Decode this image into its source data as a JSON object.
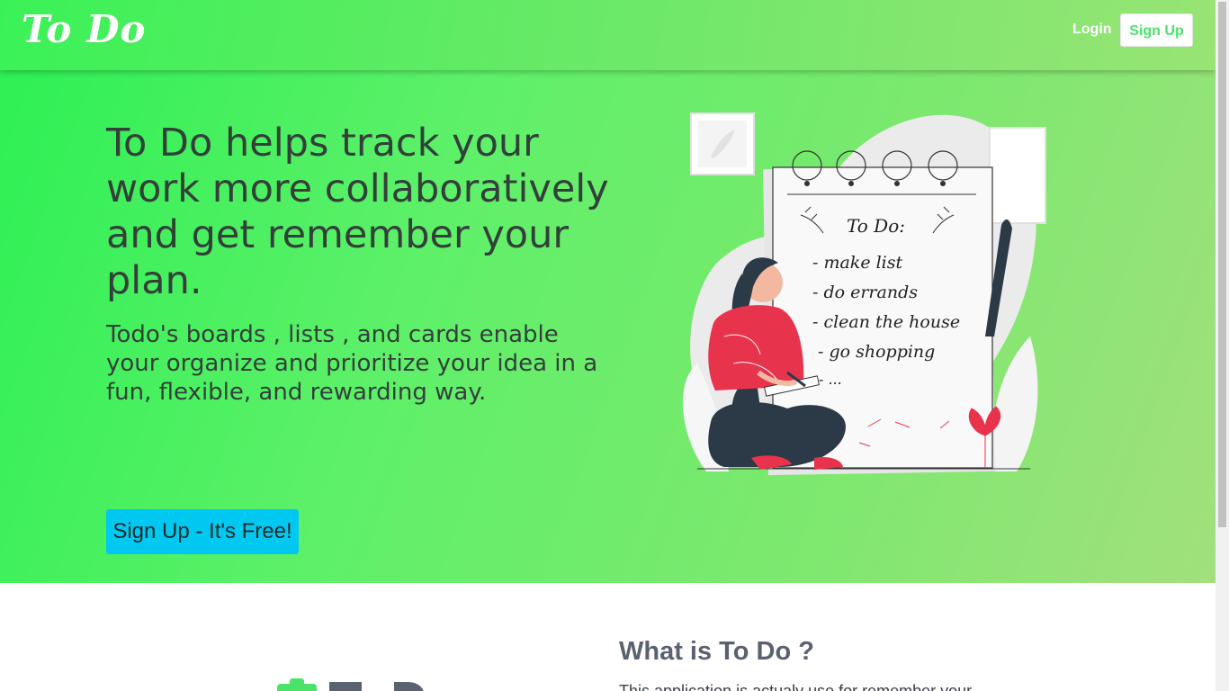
{
  "brand": {
    "name": "To Do"
  },
  "nav": {
    "login_label": "Login",
    "signup_label": "Sign Up"
  },
  "hero": {
    "headline": "To Do helps track your work more collaboratively and get remember your plan.",
    "subtext": "Todo's boards , lists , and cards enable your organize and prioritize your idea in a fun, flexible, and rewarding way.",
    "cta_label": "Sign Up - It's Free!",
    "illustration": {
      "note_title": "To Do:",
      "note_items": [
        "- make list",
        "- do errands",
        "- clean the house",
        "- go shopping",
        "- ..."
      ]
    }
  },
  "about": {
    "title": "What is To Do ?",
    "text": "This application is actualy use for remember your",
    "logo_text": "To Do"
  },
  "colors": {
    "accent": "#4be367",
    "cta": "#00c8f0",
    "text": "#33403a"
  }
}
